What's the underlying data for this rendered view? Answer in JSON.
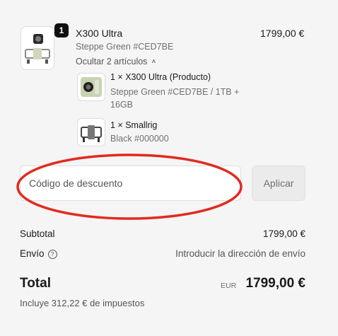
{
  "product": {
    "quantity": "1",
    "title": "X300 Ultra",
    "variant": "Steppe Green #CED7BE",
    "price": "1799,00 €",
    "toggle_label": "Ocultar 2 artículos"
  },
  "bundle_items": [
    {
      "title": "1 × X300 Ultra (Producto)",
      "variant_line1": "Steppe Green #CED7BE / 1TB +",
      "variant_line2": "16GB"
    },
    {
      "title": "1 × Smallrig",
      "variant_line1": "Black #000000"
    }
  ],
  "discount": {
    "placeholder": "Código de descuento",
    "apply_label": "Aplicar",
    "highlight_color": "#e02b20"
  },
  "totals": {
    "subtotal_label": "Subtotal",
    "subtotal_value": "1799,00 €",
    "shipping_label": "Envío",
    "shipping_value": "Introducir la dirección de envío",
    "total_label": "Total",
    "currency": "EUR",
    "total_value": "1799,00 €",
    "tax_note": "Incluye 312,22 € de impuestos"
  }
}
